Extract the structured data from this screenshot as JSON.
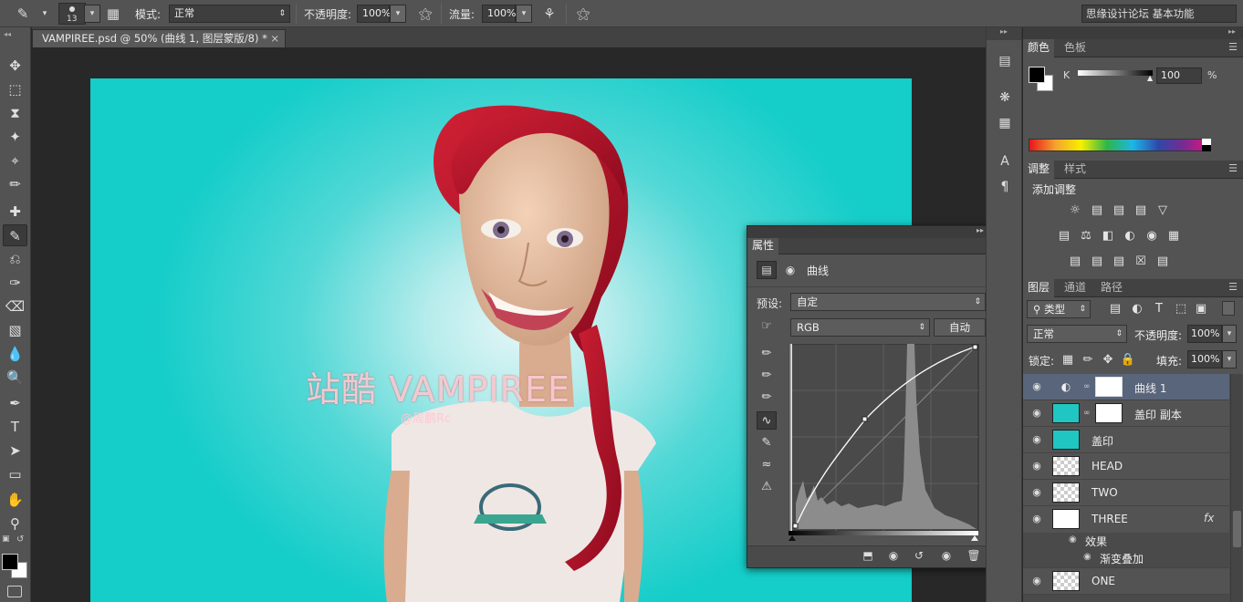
{
  "options_bar": {
    "brush_size": "13",
    "mode_label": "模式:",
    "mode_value": "正常",
    "opacity_label": "不透明度:",
    "opacity_value": "100%",
    "flow_label": "流量:",
    "flow_value": "100%",
    "watermark": "思缘设计论坛 基本功能"
  },
  "document_tab": {
    "title": "VAMPIREE.psd @ 50% (曲线 1, 图层蒙版/8) *",
    "close": "×"
  },
  "canvas": {
    "overlay_title": "站酷 VAMPIREE",
    "overlay_subtitle": "@周鹏Rc"
  },
  "color_panel": {
    "tabs": [
      "颜色",
      "色板"
    ],
    "channel_label": "K",
    "value": "100",
    "unit": "%"
  },
  "adjust_panel": {
    "tabs": [
      "调整",
      "样式"
    ],
    "heading": "添加调整"
  },
  "layers_panel": {
    "tabs": [
      "图层",
      "通道",
      "路径"
    ],
    "filter_label": "类型",
    "blend_mode": "正常",
    "opacity_label": "不透明度:",
    "opacity_value": "100%",
    "lock_label": "锁定:",
    "fill_label": "填充:",
    "fill_value": "100%",
    "layers": [
      {
        "name": "曲线 1"
      },
      {
        "name": "盖印 副本"
      },
      {
        "name": "盖印"
      },
      {
        "name": "HEAD"
      },
      {
        "name": "TWO"
      },
      {
        "name": "THREE",
        "fx": "fx"
      },
      {
        "name": "效果"
      },
      {
        "name": "渐变叠加"
      },
      {
        "name": "ONE"
      }
    ]
  },
  "properties_panel": {
    "tab": "属性",
    "type_label": "曲线",
    "preset_label": "预设:",
    "preset_value": "自定",
    "channel_value": "RGB",
    "auto_button": "自动"
  },
  "colors": {
    "panel_bg": "#535353",
    "dark_bg": "#282828",
    "canvas_teal": "#15cdc9",
    "selected_layer": "#59657a",
    "hair_red": "#b3122c"
  }
}
